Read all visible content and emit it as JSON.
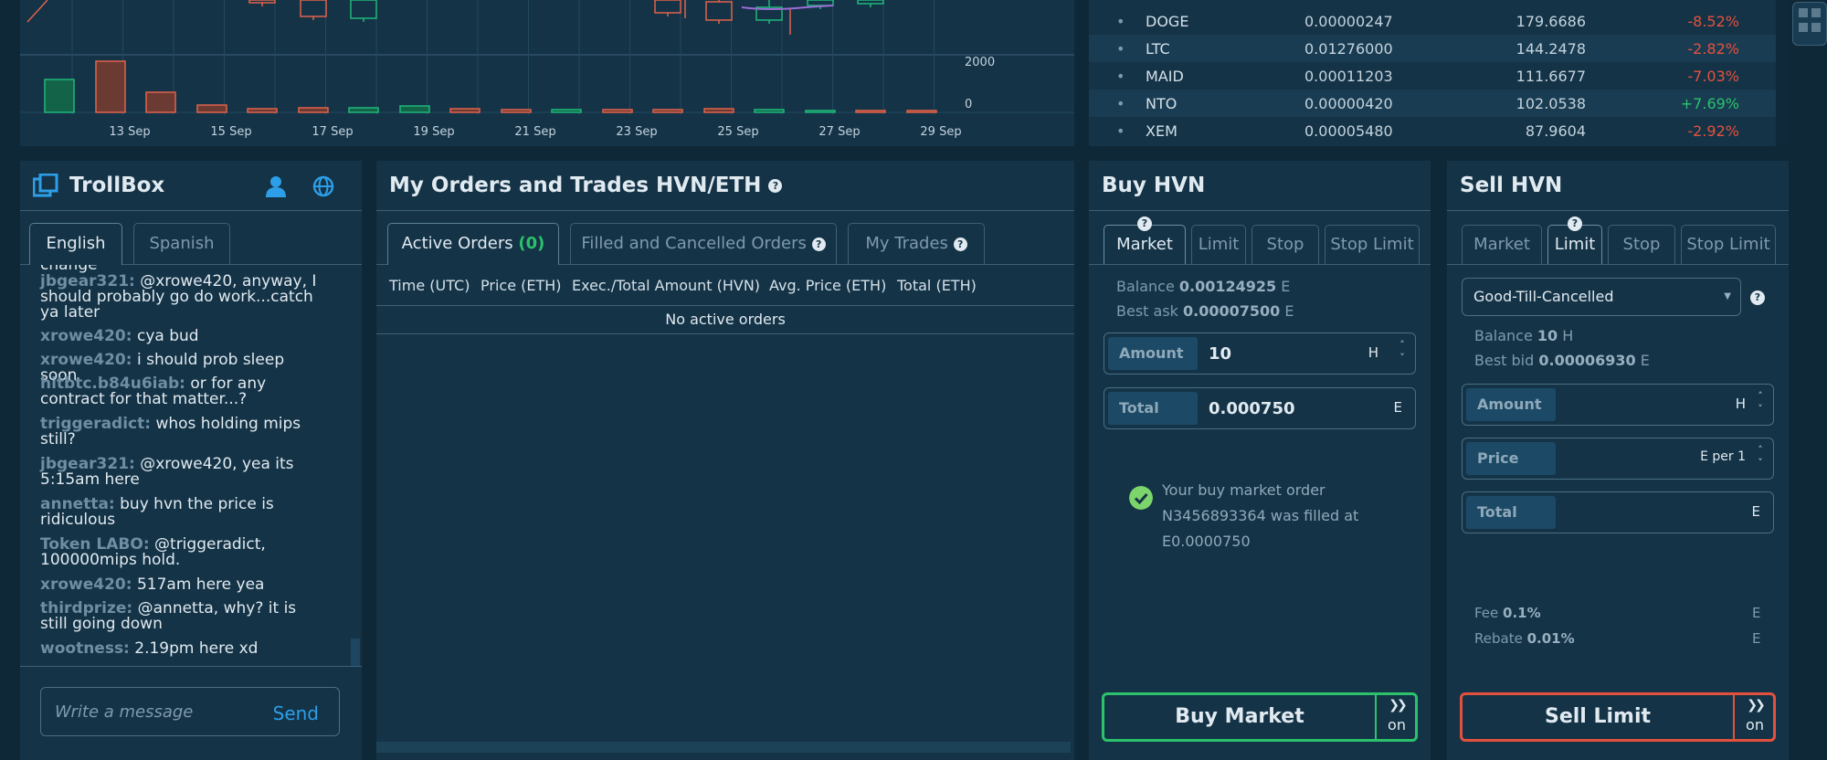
{
  "chart": {
    "x_ticks": [
      "13 Sep",
      "15 Sep",
      "17 Sep",
      "19 Sep",
      "21 Sep",
      "23 Sep",
      "25 Sep",
      "27 Sep",
      "29 Sep"
    ],
    "y_ticks": [
      "2000",
      "0"
    ],
    "colors": {
      "up": "#1fb87a",
      "down": "#e2624a",
      "grid": "#23485e",
      "ma": "#9b6bd6"
    }
  },
  "tickers": [
    {
      "symbol": "DOGE",
      "price": "0.00000247",
      "volume": "179.6686",
      "change": "-8.52%",
      "dir": "neg"
    },
    {
      "symbol": "LTC",
      "price": "0.01276000",
      "volume": "144.2478",
      "change": "-2.82%",
      "dir": "neg"
    },
    {
      "symbol": "MAID",
      "price": "0.00011203",
      "volume": "111.6677",
      "change": "-7.03%",
      "dir": "neg"
    },
    {
      "symbol": "NTO",
      "price": "0.00000420",
      "volume": "102.0538",
      "change": "+7.69%",
      "dir": "pos"
    },
    {
      "symbol": "XEM",
      "price": "0.00005480",
      "volume": "87.9604",
      "change": "-2.92%",
      "dir": "neg"
    }
  ],
  "trollbox": {
    "title": "TrollBox",
    "tabs": [
      "English",
      "Spanish"
    ],
    "messages": [
      {
        "user": "",
        "text": "change"
      },
      {
        "user": "jbgear321:",
        "text": "@xrowe420, anyway, I should probably go do work...catch ya later"
      },
      {
        "user": "xrowe420:",
        "text": "cya bud"
      },
      {
        "user": "xrowe420:",
        "text": "i should prob sleep soon"
      },
      {
        "user": "hitbtc.b84u6iab:",
        "text": "or for any contract for that matter...?"
      },
      {
        "user": "triggeradict:",
        "text": "whos holding mips still?"
      },
      {
        "user": "jbgear321:",
        "text": "@xrowe420, yea its 5:15am here"
      },
      {
        "user": "annetta:",
        "text": "buy hvn the price is ridiculous"
      },
      {
        "user": "Token LABO:",
        "text": "@triggeradict, 100000mips hold."
      },
      {
        "user": "xrowe420:",
        "text": "517am here yea"
      },
      {
        "user": "thirdprize:",
        "text": "@annetta, why? it is still going down"
      },
      {
        "user": "wootness:",
        "text": "2.19pm here xd"
      }
    ],
    "input_placeholder": "Write a message",
    "send_label": "Send"
  },
  "orders": {
    "title": "My Orders and Trades HVN/ETH",
    "tabs": [
      {
        "label": "Active Orders",
        "count": "(0)"
      },
      {
        "label": "Filled and Cancelled Orders"
      },
      {
        "label": "My Trades"
      }
    ],
    "columns": [
      "Time (UTC)",
      "Price (ETH)",
      "Exec./Total Amount (HVN)",
      "Avg. Price (ETH)",
      "Total (ETH)"
    ],
    "empty_text": "No active orders"
  },
  "buy": {
    "title": "Buy HVN",
    "tabs": [
      "Market",
      "Limit",
      "Stop",
      "Stop Limit"
    ],
    "balance_label": "Balance",
    "balance_value": "0.00124925",
    "balance_unit": "E",
    "best_label": "Best ask",
    "best_value": "0.00007500",
    "best_unit": "E",
    "amount_label": "Amount",
    "amount_value": "10",
    "amount_unit": "H",
    "total_label": "Total",
    "total_value": "0.000750",
    "total_unit": "E",
    "notice": "Your buy market order N3456893364 was filled at E0.0000750",
    "action_label": "Buy  Market",
    "toggle_label": "on"
  },
  "sell": {
    "title": "Sell HVN",
    "tabs": [
      "Market",
      "Limit",
      "Stop",
      "Stop Limit"
    ],
    "tif": "Good-Till-Cancelled",
    "balance_label": "Balance",
    "balance_value": "10",
    "balance_unit": "H",
    "best_label": "Best bid",
    "best_value": "0.00006930",
    "best_unit": "E",
    "amount_label": "Amount",
    "amount_unit": "H",
    "price_label": "Price",
    "price_unit": "E per 1",
    "total_label": "Total",
    "total_unit": "E",
    "fee_label": "Fee",
    "fee_value": "0.1%",
    "fee_unit": "E",
    "rebate_label": "Rebate",
    "rebate_value": "0.01%",
    "rebate_unit": "E",
    "action_label": "Sell  Limit",
    "toggle_label": "on"
  }
}
